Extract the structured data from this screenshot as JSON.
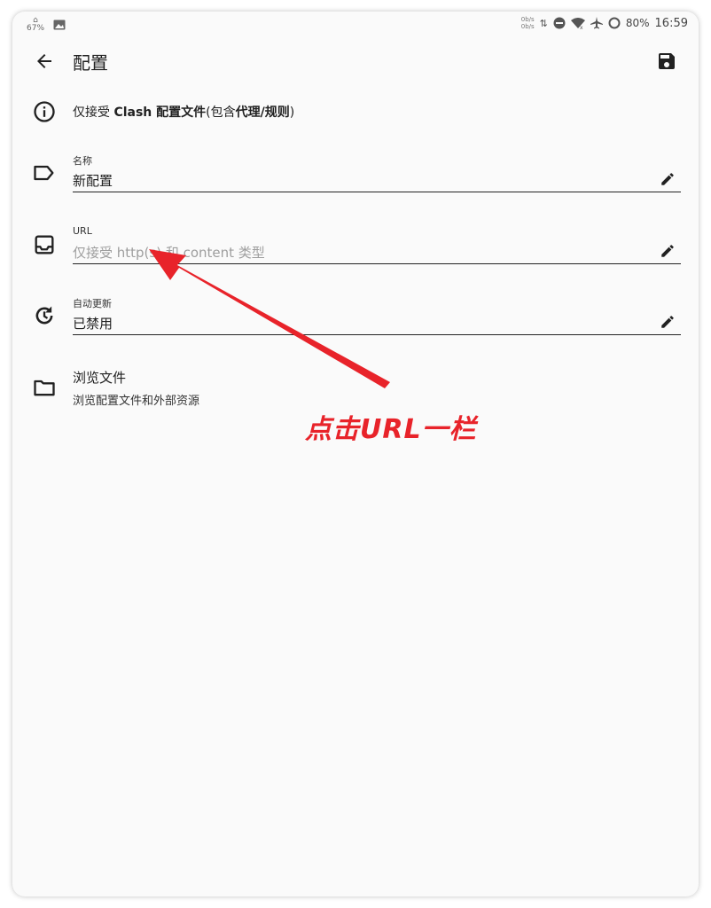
{
  "status_bar": {
    "left_small": "67%",
    "net_up": "0b/s",
    "net_down": "0b/s",
    "battery": "80%",
    "time": "16:59"
  },
  "app_bar": {
    "title": "配置"
  },
  "info": {
    "prefix": "仅接受 ",
    "bold1": "Clash 配置文件",
    "mid": "(包含",
    "bold2": "代理",
    "slash": "/",
    "bold3": "规则",
    "suffix": ")"
  },
  "fields": {
    "name": {
      "label": "名称",
      "value": "新配置"
    },
    "url": {
      "label": "URL",
      "placeholder": "仅接受 http(s) 和 content 类型"
    },
    "auto_update": {
      "label": "自动更新",
      "value": "已禁用"
    }
  },
  "browse": {
    "title": "浏览文件",
    "subtitle": "浏览配置文件和外部资源"
  },
  "annotation": {
    "text": "点击URL一栏",
    "color": "#e8232a"
  },
  "icons": {
    "back": "arrow-left-icon",
    "save": "floppy-disk-icon",
    "info": "info-circle-icon",
    "name": "label-tag-icon",
    "url": "inbox-tray-icon",
    "auto_update": "history-clock-icon",
    "browse": "folder-icon",
    "edit": "pencil-icon"
  }
}
